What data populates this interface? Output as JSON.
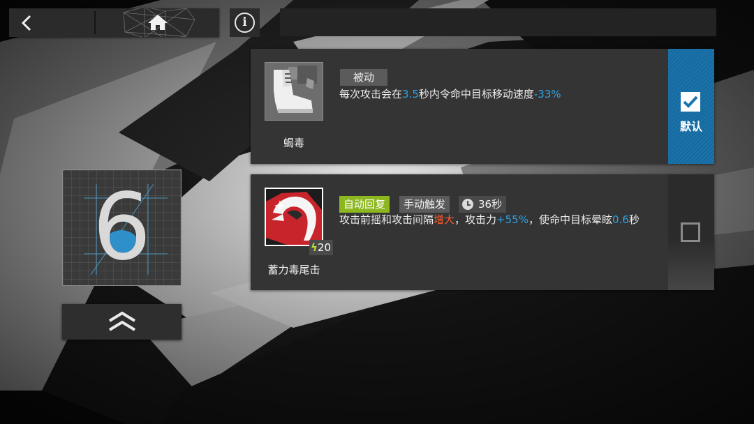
{
  "level": {
    "value": "6"
  },
  "skills": [
    {
      "name": "蝎毒",
      "tag": "被动",
      "desc": {
        "t1": "每次攻击会在",
        "v1": "3.5",
        "t2": "秒内令命中目标移动速度",
        "v2": "-33%"
      },
      "selected": true,
      "default_label": "默认",
      "icon": "boot-icon"
    },
    {
      "name": "蓄力毒尾击",
      "tags": {
        "recovery": "自动回复",
        "trigger": "手动触发",
        "duration": "36秒"
      },
      "sp_cost": "20",
      "desc": {
        "t1": "攻击前摇和攻击间隔",
        "v1": "增大",
        "t2": "，攻击力",
        "v2": "+55%",
        "t3": "，使命中目标晕眩",
        "v3": "0.6",
        "t4": "秒"
      },
      "selected": false,
      "icon": "scorpion-tail-icon"
    }
  ],
  "colors": {
    "accent_blue": "#2ea2e6",
    "select_blue": "#1a74ad",
    "auto_green": "#8cb71f",
    "highlight_red": "#ff5a2a"
  }
}
